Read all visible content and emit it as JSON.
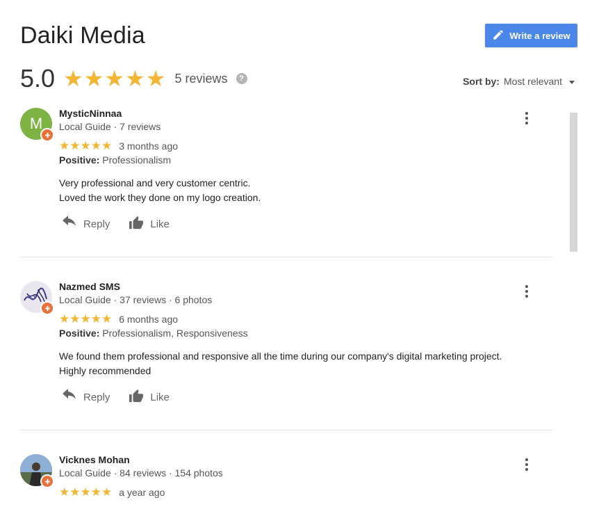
{
  "header": {
    "title": "Daiki Media",
    "write_review_label": "Write a review",
    "rating": "5.0",
    "stars": "★★★★★",
    "reviews_count": "5 reviews",
    "help_glyph": "?"
  },
  "sort": {
    "label": "Sort by:",
    "value": "Most relevant"
  },
  "colors": {
    "accent": "#4a87e8",
    "star": "#f2b632",
    "badge": "#e8713a"
  },
  "reviews": [
    {
      "avatar_letter": "M",
      "name": "MysticNinnaa",
      "meta": "Local Guide · 7 reviews",
      "stars": "★★★★★",
      "time": "3 months ago",
      "positive_label": "Positive:",
      "positive_value": "Professionalism",
      "text_line1": "Very professional and very customer centric.",
      "text_line2": "Loved the work they done on my logo creation.",
      "reply_label": "Reply",
      "like_label": "Like"
    },
    {
      "avatar_letter": "",
      "name": "Nazmed SMS",
      "meta": "Local Guide · 37 reviews · 6 photos",
      "stars": "★★★★★",
      "time": "6 months ago",
      "positive_label": "Positive:",
      "positive_value": "Professionalism, Responsiveness",
      "text_line1": "We found them professional and responsive all the time during our company's digital marketing project.",
      "text_line2": "Highly recommended",
      "reply_label": "Reply",
      "like_label": "Like"
    },
    {
      "avatar_letter": "",
      "name": "Vicknes Mohan",
      "meta": "Local Guide · 84 reviews · 154 photos",
      "stars": "★★★★★",
      "time": "a year ago"
    }
  ],
  "icons": [
    "pencil-icon",
    "help-icon",
    "caret-down-icon",
    "more-vert-icon",
    "reply-icon",
    "thumb-up-icon",
    "local-guide-badge-icon"
  ]
}
